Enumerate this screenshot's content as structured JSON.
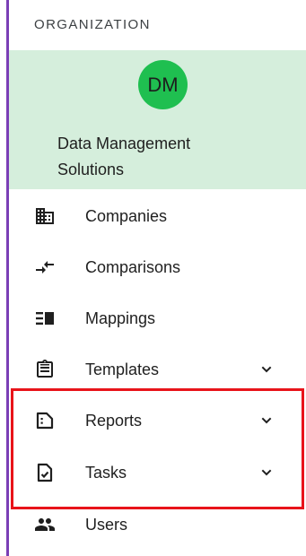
{
  "sidebar": {
    "section_label": "ORGANIZATION",
    "organization": {
      "avatar_initials": "DM",
      "avatar_color": "#1fbf50",
      "name": "Data Management Solutions",
      "card_color": "#d5eedc"
    },
    "items": [
      {
        "label": "Companies",
        "icon": "building-icon",
        "expandable": false
      },
      {
        "label": "Comparisons",
        "icon": "compare-arrows-icon",
        "expandable": false
      },
      {
        "label": "Mappings",
        "icon": "mapping-icon",
        "expandable": false
      },
      {
        "label": "Templates",
        "icon": "clipboard-icon",
        "expandable": true
      },
      {
        "label": "Reports",
        "icon": "report-icon",
        "expandable": true
      },
      {
        "label": "Tasks",
        "icon": "task-check-icon",
        "expandable": true
      },
      {
        "label": "Users",
        "icon": "users-icon",
        "expandable": false
      }
    ],
    "accent_color": "#7b3fb6",
    "highlight_color": "#e8141a"
  }
}
